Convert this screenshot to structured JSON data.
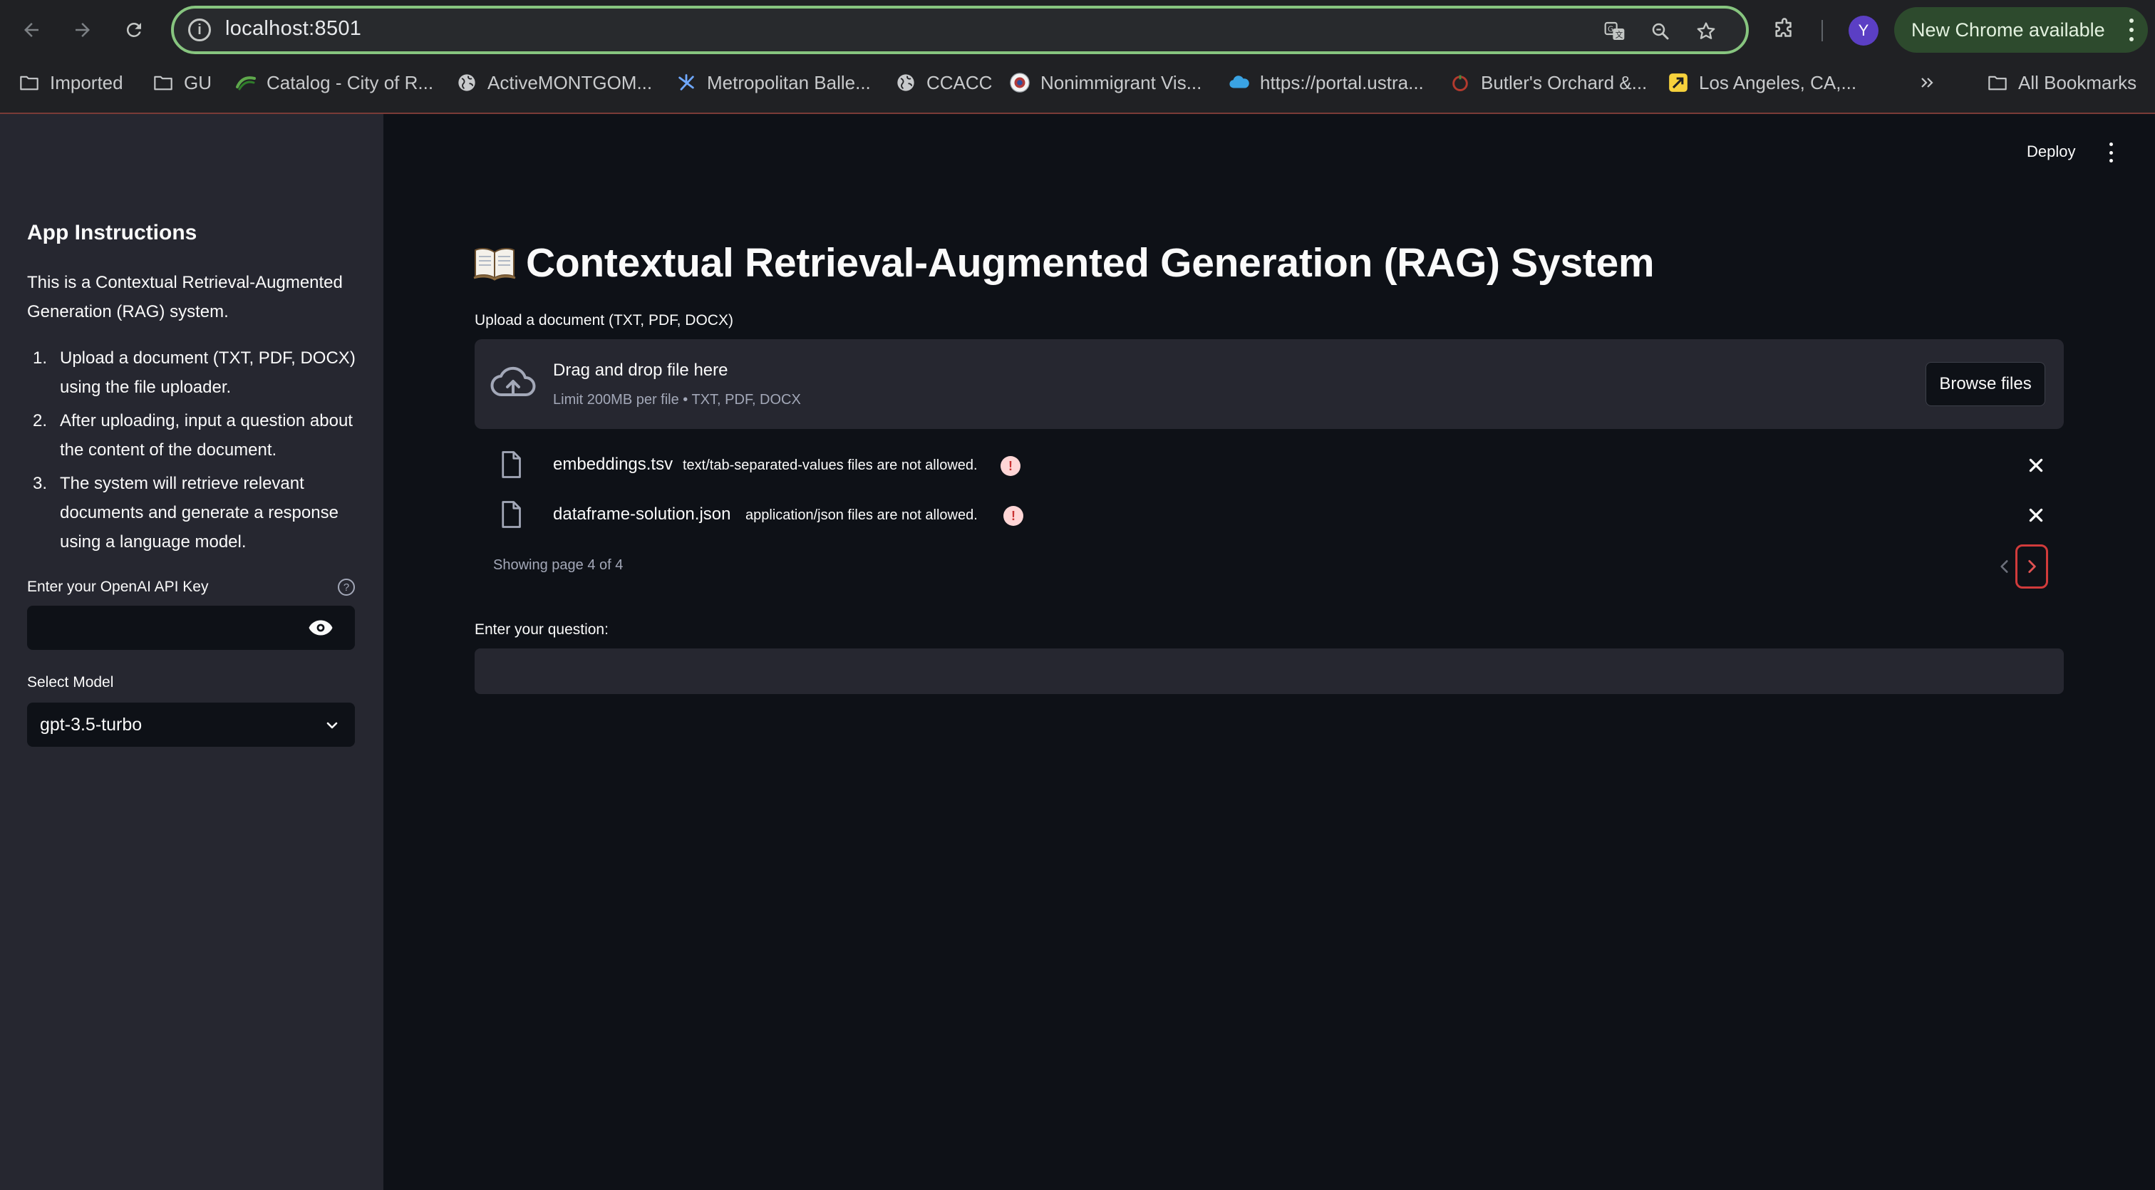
{
  "browser": {
    "url": "localhost:8501",
    "update_label": "New Chrome available",
    "profile_initial": "Y",
    "bookmarks": [
      {
        "label": "Imported",
        "icon": "folder-icon"
      },
      {
        "label": "GU",
        "icon": "folder-icon"
      },
      {
        "label": "Catalog - City of R...",
        "icon": "site-icon"
      },
      {
        "label": "ActiveMONTGOM...",
        "icon": "globe-icon"
      },
      {
        "label": "Metropolitan Balle...",
        "icon": "site-icon"
      },
      {
        "label": "CCACC",
        "icon": "globe-icon"
      },
      {
        "label": "Nonimmigrant Vis...",
        "icon": "seal-icon"
      },
      {
        "label": "https://portal.ustra...",
        "icon": "cloud-icon"
      },
      {
        "label": "Butler's Orchard &...",
        "icon": "site-icon"
      },
      {
        "label": "Los Angeles, CA,...",
        "icon": "site-icon"
      }
    ],
    "all_bookmarks_label": "All Bookmarks"
  },
  "app": {
    "deploy_label": "Deploy",
    "title_emoji": "open-book-icon",
    "title": "Contextual Retrieval-Augmented Generation (RAG) System",
    "upload_label": "Upload a document (TXT, PDF, DOCX)",
    "dropzone": {
      "title": "Drag and drop file here",
      "subtitle": "Limit 200MB per file • TXT, PDF, DOCX",
      "browse_label": "Browse files"
    },
    "files": [
      {
        "name": "embeddings.tsv",
        "error": "text/tab-separated-values files are not allowed."
      },
      {
        "name": "dataframe-solution.json",
        "error": "application/json files are not allowed."
      }
    ],
    "pager_text": "Showing page 4 of 4",
    "question_label": "Enter your question:",
    "question_value": ""
  },
  "sidebar": {
    "title": "App Instructions",
    "description": "This is a Contextual Retrieval-Augmented Generation (RAG) system.",
    "steps": [
      {
        "num": "1.",
        "text": "Upload a document (TXT, PDF, DOCX) using the file uploader."
      },
      {
        "num": "2.",
        "text": "After uploading, input a question about the content of the document."
      },
      {
        "num": "3.",
        "text": "The system will retrieve relevant documents and generate a response using a language model."
      }
    ],
    "api_key_label": "Enter your OpenAI API Key",
    "api_key_value": "",
    "model_label": "Select Model",
    "model_value": "gpt-3.5-turbo"
  },
  "colors": {
    "app_bg": "#0e1117",
    "sidebar_bg": "#262730",
    "error_accent": "#c93232",
    "omnibox_border": "#87c57f"
  }
}
